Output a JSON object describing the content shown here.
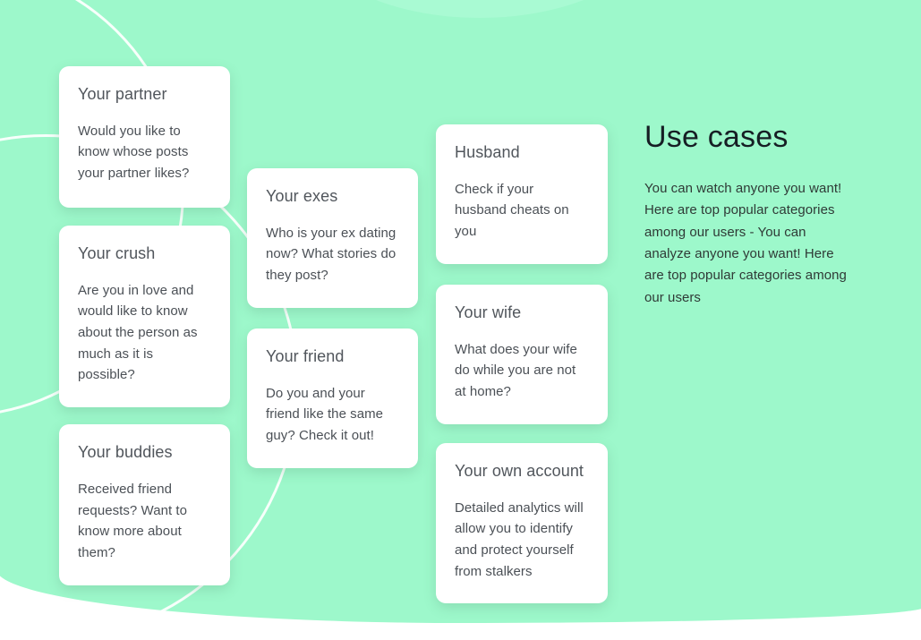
{
  "theme": {
    "background_mint": "#9df8cb",
    "card_background": "#ffffff",
    "card_title_color": "#51565c",
    "card_text_color": "#4b5056",
    "heading_color": "#161e24",
    "body_color": "#2f3a36",
    "decor_line_color": "#ffffff"
  },
  "use_cases": {
    "heading": "Use cases",
    "body": "You can watch anyone you want! Here are top popular categories among our users - You can analyze anyone you want! Here are top popular categories among our users"
  },
  "columns": [
    {
      "id": "column-1",
      "cards": [
        {
          "id": "your-partner",
          "title": "Your partner",
          "text": "Would you like to know whose posts your partner likes?"
        },
        {
          "id": "your-crush",
          "title": "Your crush",
          "text": "Are you in love and would like to know about the person as much as it is possible?"
        },
        {
          "id": "your-buddies",
          "title": "Your buddies",
          "text": "Received friend requests? Want to know more about them?"
        }
      ]
    },
    {
      "id": "column-2",
      "cards": [
        {
          "id": "your-exes",
          "title": "Your exes",
          "text": "Who is your ex dating now? What stories do they post?"
        },
        {
          "id": "your-friend",
          "title": "Your friend",
          "text": "Do you and your friend like the same guy? Check it out!"
        }
      ]
    },
    {
      "id": "column-3",
      "cards": [
        {
          "id": "husband",
          "title": "Husband",
          "text": "Check if your husband cheats on you"
        },
        {
          "id": "your-wife",
          "title": "Your wife",
          "text": "What does your wife do while you are not at home?"
        },
        {
          "id": "your-own-account",
          "title": "Your own account",
          "text": "Detailed analytics will allow you to identify and protect yourself from stalkers"
        }
      ]
    }
  ]
}
